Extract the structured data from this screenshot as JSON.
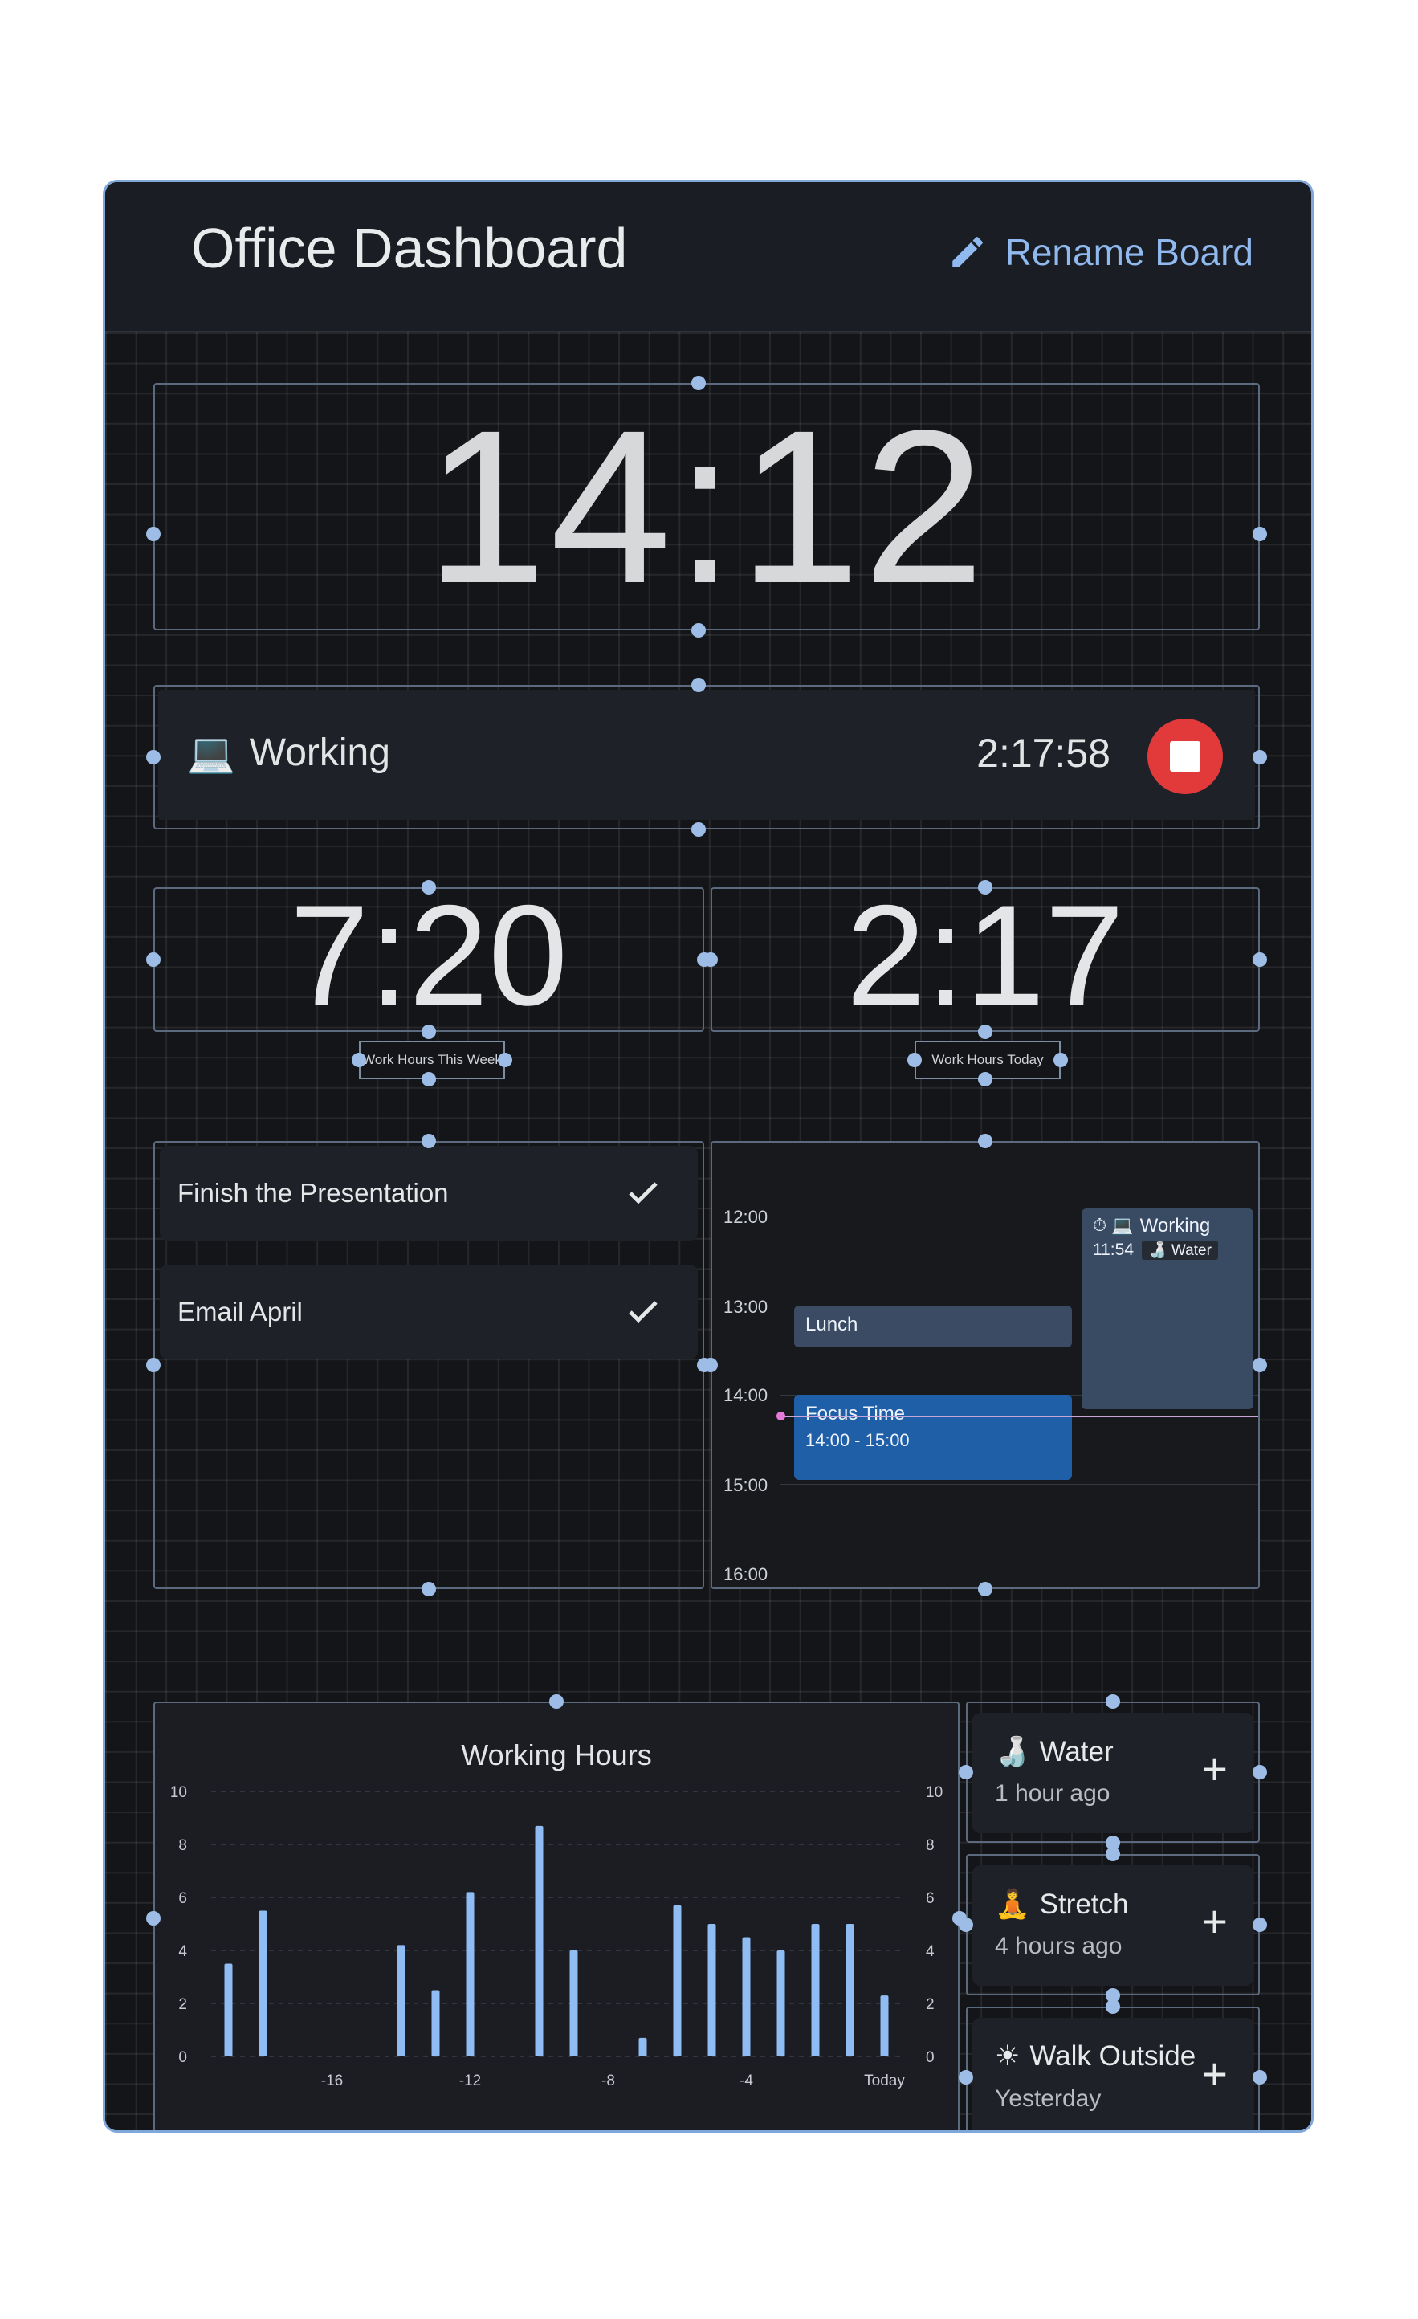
{
  "header": {
    "title": "Office Dashboard",
    "rename_label": "Rename Board"
  },
  "clock": {
    "time": "14:12"
  },
  "timer": {
    "emoji": "💻",
    "label": "Working",
    "elapsed": "2:17:58"
  },
  "stats": [
    {
      "value": "7:20",
      "label": "Work Hours This Week"
    },
    {
      "value": "2:17",
      "label": "Work Hours Today"
    }
  ],
  "tasks": [
    {
      "title": "Finish the Presentation"
    },
    {
      "title": "Email April"
    }
  ],
  "calendar": {
    "hours": [
      "12:00",
      "13:00",
      "14:00",
      "15:00",
      "16:00"
    ],
    "events": {
      "lunch": "Lunch",
      "focus_title": "Focus Time",
      "focus_range": "14:00 - 15:00",
      "working_icons": "⏱ 💻",
      "working_title": "Working",
      "working_start": "11:54",
      "water_chip": "🍶 Water"
    }
  },
  "chart_data": {
    "type": "bar",
    "title": "Working Hours",
    "x": [
      -19,
      -18,
      -17,
      -16,
      -15,
      -14,
      -13,
      -12,
      -11,
      -10,
      -9,
      -8,
      -7,
      -6,
      -5,
      -4,
      -3,
      -2,
      -1,
      0
    ],
    "values": [
      3.5,
      5.5,
      0,
      0,
      0,
      4.2,
      2.5,
      6.2,
      0,
      8.7,
      4.0,
      0,
      0.7,
      5.7,
      5.0,
      4.5,
      4.0,
      5.0,
      5.0,
      2.3
    ],
    "x_tick_labels": [
      "-16",
      "-12",
      "-8",
      "-4",
      "Today"
    ],
    "x_tick_values": [
      -16,
      -12,
      -8,
      -4,
      0
    ],
    "y_ticks_left": [
      "0",
      "2",
      "4",
      "6",
      "8",
      "10"
    ],
    "y_ticks_right": [
      "0",
      "2",
      "4",
      "6",
      "8",
      "10"
    ],
    "ylim": [
      0,
      10
    ],
    "bar_color": "#8fbcf2",
    "grid": true
  },
  "habits": [
    {
      "emoji": "🍶",
      "name": "Water",
      "ago": "1 hour ago"
    },
    {
      "emoji": "🧘",
      "name": "Stretch",
      "ago": "4 hours ago"
    },
    {
      "emoji": "☀",
      "name": "Walk Outside",
      "ago": "Yesterday"
    }
  ],
  "plus_symbol": "+",
  "colors": {
    "accent": "#8fb9ef",
    "stop": "#e23a3a",
    "focus_event": "#1f5fa8",
    "lunch_event": "#3a4b63"
  }
}
